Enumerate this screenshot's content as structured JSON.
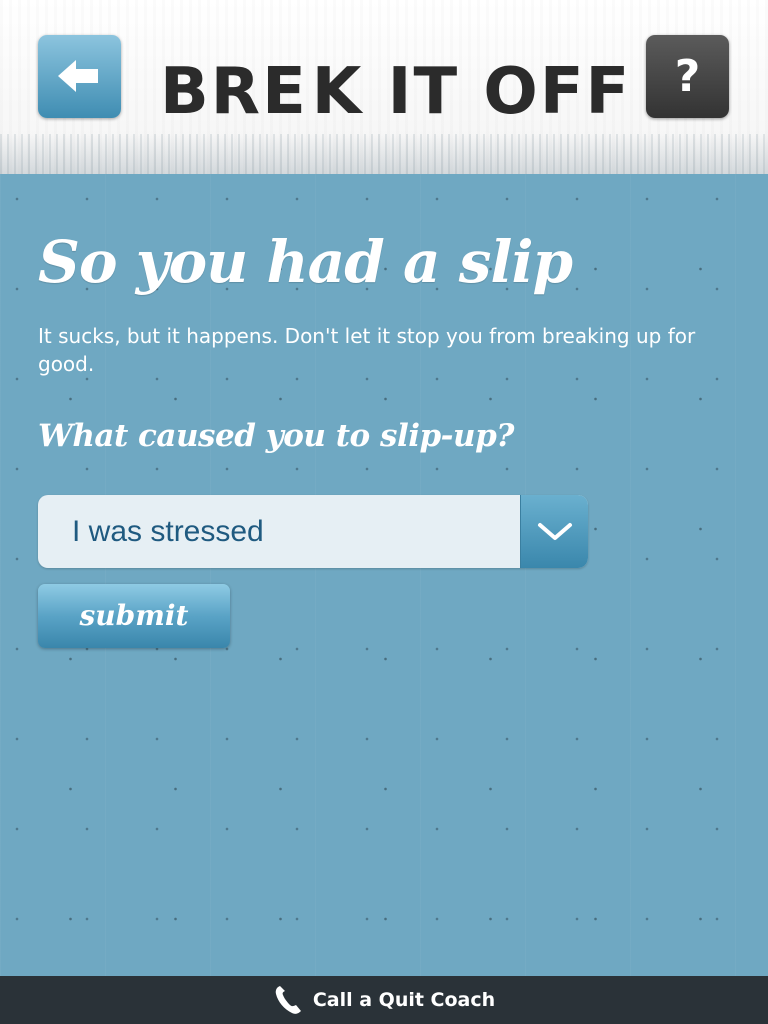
{
  "header": {
    "back_icon": "arrow-left-icon",
    "help_label": "?",
    "logo": {
      "text_before": "BRE",
      "heart_icon": "broken-heart-icon",
      "text_after": "K IT OFF",
      "heart_color": "#c8202a"
    }
  },
  "main": {
    "title": "So you had a slip",
    "intro": "It sucks, but it happens. Don't let it stop you from breaking up for good.",
    "question": "What caused you to slip-up?",
    "select": {
      "value": "I was stressed",
      "icon": "chevron-down-icon"
    },
    "submit_label": "submit"
  },
  "footer": {
    "icon": "phone-icon",
    "label": "Call a Quit Coach"
  },
  "colors": {
    "background": "#6fa8c2",
    "accent": "#3a87ac",
    "footer": "#2a3238"
  }
}
